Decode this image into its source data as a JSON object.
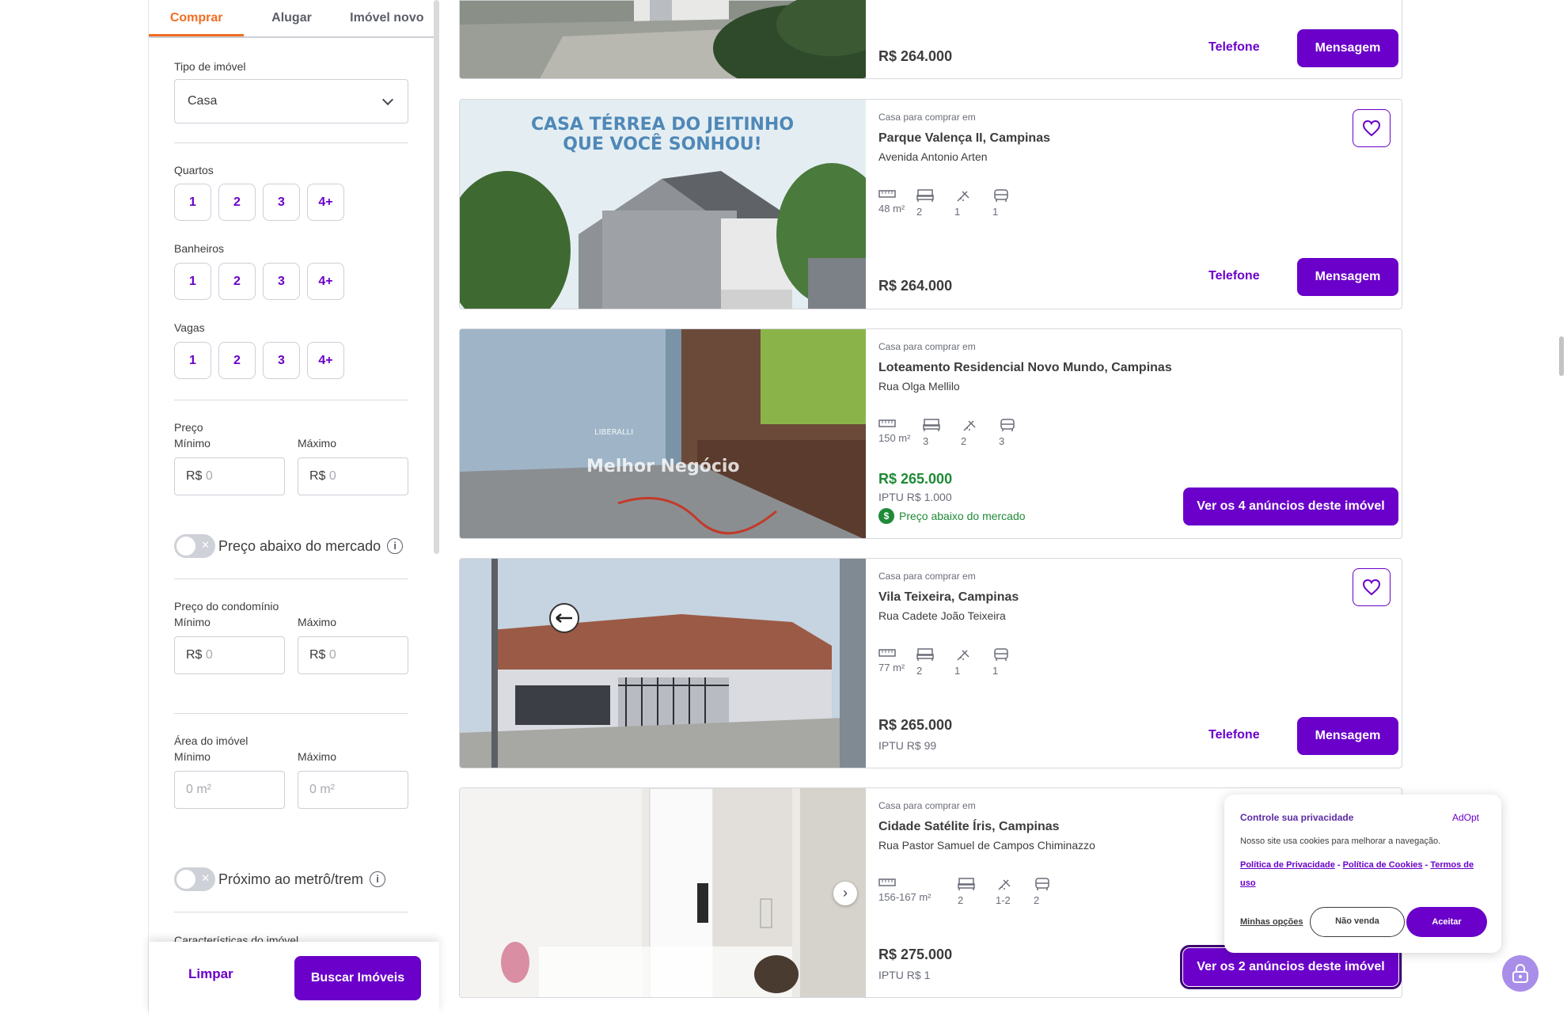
{
  "sidebar": {
    "tabs": [
      "Comprar",
      "Alugar",
      "Imóvel novo"
    ],
    "tipo_label": "Tipo de imóvel",
    "tipo_value": "Casa",
    "quartos_label": "Quartos",
    "banheiros_label": "Banheiros",
    "vagas_label": "Vagas",
    "chips": [
      "1",
      "2",
      "3",
      "4+"
    ],
    "preco_label": "Preço",
    "minimo_label": "Mínimo",
    "maximo_label": "Máximo",
    "currency": "R$",
    "zero_placeholder": "0",
    "abaixo_label": "Preço abaixo do mercado",
    "condominio_label": "Preço do condomínio",
    "area_label": "Área do imóvel",
    "area_placeholder": "0 m²",
    "metro_label": "Próximo ao metrô/trem",
    "caracteristicas_label": "Características do imóvel",
    "limpar": "Limpar",
    "buscar": "Buscar Imóveis"
  },
  "common": {
    "kind": "Casa para comprar em",
    "telefone": "Telefone",
    "mensagem": "Mensagem"
  },
  "cards": [
    {
      "price": "R$ 264.000"
    },
    {
      "title": "Parque Valença II, Campinas",
      "street": "Avenida Antonio Arten",
      "area": "48 m²",
      "quartos": "2",
      "banheiros": "1",
      "vagas": "1",
      "price": "R$ 264.000",
      "photo_text_1": "CASA TÉRREA DO JEITINHO",
      "photo_text_2": "QUE VOCÊ SONHOU!"
    },
    {
      "title": "Loteamento Residencial Novo Mundo, Campinas",
      "street": "Rua Olga Mellilo",
      "area": "150 m²",
      "quartos": "3",
      "banheiros": "2",
      "vagas": "3",
      "price": "R$ 265.000",
      "iptu": "IPTU R$ 1.000",
      "below_market": "Preço abaixo do mercado",
      "cta": "Ver os 4 anúncios deste imóvel",
      "watermark_small": "LIBERALLI",
      "watermark": "Melhor Negócio"
    },
    {
      "title": "Vila Teixeira, Campinas",
      "street": "Rua Cadete João Teixeira",
      "area": "77 m²",
      "quartos": "2",
      "banheiros": "1",
      "vagas": "1",
      "price": "R$ 265.000",
      "iptu": "IPTU R$ 99"
    },
    {
      "title": "Cidade Satélite Íris, Campinas",
      "street": "Rua Pastor Samuel de Campos Chiminazzo",
      "area": "156-167 m²",
      "quartos": "2",
      "banheiros": "1-2",
      "vagas": "2",
      "price": "R$ 275.000",
      "iptu": "IPTU R$ 1",
      "cta": "Ver os 2 anúncios deste imóvel"
    }
  ],
  "cookie": {
    "title": "Controle sua privacidade",
    "brand": "AdOpt",
    "desc": "Nosso site usa cookies para melhorar a navegação.",
    "link_privacy": "Política de Privacidade",
    "link_cookies": "Política de Cookies",
    "link_terms": "Termos de uso",
    "sep": "-",
    "options": "Minhas opções",
    "nao_venda": "Não venda",
    "aceitar": "Aceitar"
  },
  "colors": {
    "brand": "#6a00c9",
    "accent_tab": "#f26d22",
    "green": "#1f8a37"
  }
}
